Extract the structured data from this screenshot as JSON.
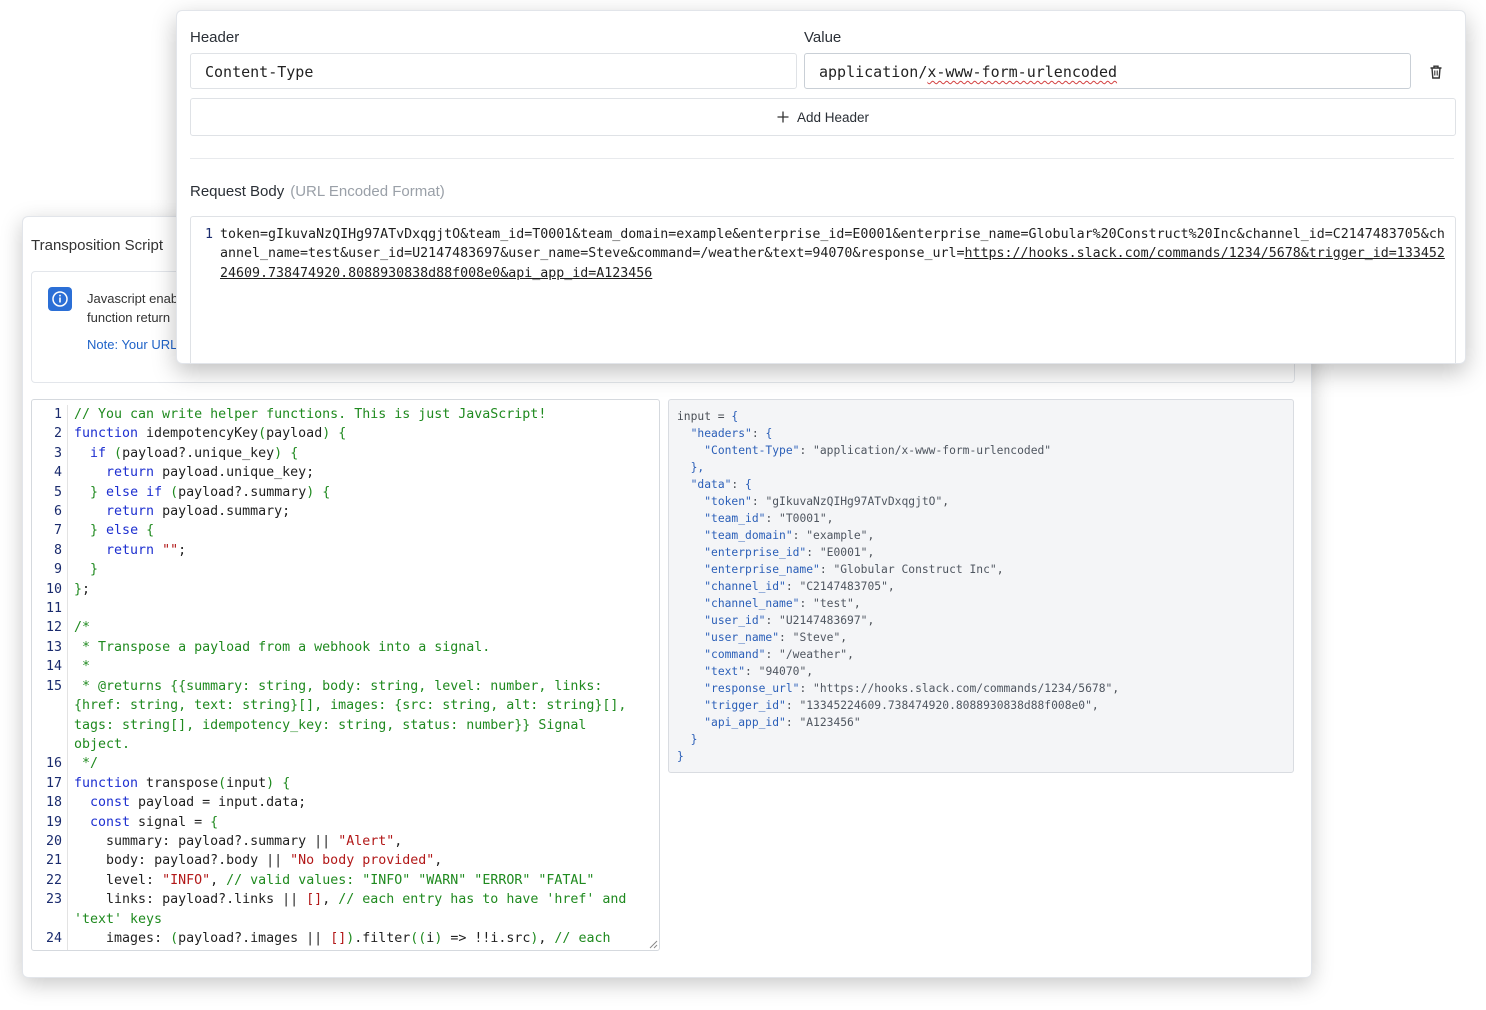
{
  "transposition": {
    "title": "Transposition Script",
    "info_line1": "Javascript enab",
    "info_line2": "function return",
    "info_note": "Note: Your URL-"
  },
  "code_editor": {
    "lines": [
      {
        "n": "1",
        "segments": [
          {
            "t": "// You can write helper functions. This is just JavaScript!",
            "c": "cm"
          }
        ]
      },
      {
        "n": "2",
        "segments": [
          {
            "t": "function",
            "c": "kw"
          },
          {
            "t": " idempotencyKey"
          },
          {
            "t": "(",
            "c": "pn"
          },
          {
            "t": "payload"
          },
          {
            "t": ")",
            "c": "pn"
          },
          {
            "t": " "
          },
          {
            "t": "{",
            "c": "pn"
          }
        ]
      },
      {
        "n": "3",
        "segments": [
          {
            "t": "  "
          },
          {
            "t": "if",
            "c": "kw"
          },
          {
            "t": " "
          },
          {
            "t": "(",
            "c": "pn"
          },
          {
            "t": "payload?.unique_key"
          },
          {
            "t": ")",
            "c": "pn"
          },
          {
            "t": " "
          },
          {
            "t": "{",
            "c": "pn"
          }
        ]
      },
      {
        "n": "4",
        "segments": [
          {
            "t": "    "
          },
          {
            "t": "return",
            "c": "kw"
          },
          {
            "t": " payload.unique_key;"
          }
        ]
      },
      {
        "n": "5",
        "segments": [
          {
            "t": "  "
          },
          {
            "t": "}",
            "c": "pn"
          },
          {
            "t": " "
          },
          {
            "t": "else",
            "c": "kw"
          },
          {
            "t": " "
          },
          {
            "t": "if",
            "c": "kw"
          },
          {
            "t": " "
          },
          {
            "t": "(",
            "c": "pn"
          },
          {
            "t": "payload?.summary"
          },
          {
            "t": ")",
            "c": "pn"
          },
          {
            "t": " "
          },
          {
            "t": "{",
            "c": "pn"
          }
        ]
      },
      {
        "n": "6",
        "segments": [
          {
            "t": "    "
          },
          {
            "t": "return",
            "c": "kw"
          },
          {
            "t": " payload.summary;"
          }
        ]
      },
      {
        "n": "7",
        "segments": [
          {
            "t": "  "
          },
          {
            "t": "}",
            "c": "pn"
          },
          {
            "t": " "
          },
          {
            "t": "else",
            "c": "kw"
          },
          {
            "t": " "
          },
          {
            "t": "{",
            "c": "pn"
          }
        ]
      },
      {
        "n": "8",
        "segments": [
          {
            "t": "    "
          },
          {
            "t": "return",
            "c": "kw"
          },
          {
            "t": " "
          },
          {
            "t": "\"\"",
            "c": "st"
          },
          {
            "t": ";"
          }
        ]
      },
      {
        "n": "9",
        "segments": [
          {
            "t": "  "
          },
          {
            "t": "}",
            "c": "pn"
          }
        ]
      },
      {
        "n": "10",
        "segments": [
          {
            "t": "}",
            "c": "pn"
          },
          {
            "t": ";"
          }
        ]
      },
      {
        "n": "11",
        "segments": [
          {
            "t": ""
          }
        ]
      },
      {
        "n": "12",
        "segments": [
          {
            "t": "/*",
            "c": "cm"
          }
        ]
      },
      {
        "n": "13",
        "segments": [
          {
            "t": " * Transpose a payload from a webhook into a signal.",
            "c": "cm"
          }
        ]
      },
      {
        "n": "14",
        "segments": [
          {
            "t": " *",
            "c": "cm"
          }
        ]
      },
      {
        "n": "15",
        "segments": [
          {
            "t": " * @returns {{summary: string, body: string, level: number, links: {href: string, text: string}[], images: {src: string, alt: string}[], tags: string[], idempotency_key: string, status: number}} Signal object.",
            "c": "cm"
          }
        ]
      },
      {
        "n": "16",
        "segments": [
          {
            "t": " */",
            "c": "cm"
          }
        ]
      },
      {
        "n": "17",
        "segments": [
          {
            "t": "function",
            "c": "kw"
          },
          {
            "t": " transpose"
          },
          {
            "t": "(",
            "c": "pn"
          },
          {
            "t": "input"
          },
          {
            "t": ")",
            "c": "pn"
          },
          {
            "t": " "
          },
          {
            "t": "{",
            "c": "pn"
          }
        ]
      },
      {
        "n": "18",
        "segments": [
          {
            "t": "  "
          },
          {
            "t": "const",
            "c": "kw"
          },
          {
            "t": " payload = input.data;"
          }
        ]
      },
      {
        "n": "19",
        "segments": [
          {
            "t": "  "
          },
          {
            "t": "const",
            "c": "kw"
          },
          {
            "t": " signal = "
          },
          {
            "t": "{",
            "c": "pn"
          }
        ]
      },
      {
        "n": "20",
        "segments": [
          {
            "t": "    summary: payload?.summary || "
          },
          {
            "t": "\"Alert\"",
            "c": "st"
          },
          {
            "t": ","
          }
        ]
      },
      {
        "n": "21",
        "segments": [
          {
            "t": "    body: payload?.body || "
          },
          {
            "t": "\"No body provided\"",
            "c": "st"
          },
          {
            "t": ","
          }
        ]
      },
      {
        "n": "22",
        "segments": [
          {
            "t": "    level: "
          },
          {
            "t": "\"INFO\"",
            "c": "st"
          },
          {
            "t": ", "
          },
          {
            "t": "// valid values: \"INFO\" \"WARN\" \"ERROR\" \"FATAL\"",
            "c": "cm"
          }
        ]
      },
      {
        "n": "23",
        "segments": [
          {
            "t": "    links: payload?.links || "
          },
          {
            "t": "[]",
            "c": "st"
          },
          {
            "t": ", "
          },
          {
            "t": "// each entry has to have 'href' and 'text' keys",
            "c": "cm"
          }
        ]
      },
      {
        "n": "24",
        "segments": [
          {
            "t": "    images: "
          },
          {
            "t": "(",
            "c": "pn"
          },
          {
            "t": "payload?.images || "
          },
          {
            "t": "[]",
            "c": "st"
          },
          {
            "t": ")",
            "c": "pn"
          },
          {
            "t": ".filter"
          },
          {
            "t": "((",
            "c": "pn"
          },
          {
            "t": "i"
          },
          {
            "t": ")",
            "c": "pn"
          },
          {
            "t": " => !!i.src"
          },
          {
            "t": ")",
            "c": "pn"
          },
          {
            "t": ", "
          },
          {
            "t": "// each entry has to have 'src' and 'alt' keys",
            "c": "cm"
          }
        ]
      }
    ]
  },
  "json_preview": {
    "lines": [
      [
        {
          "t": "input = "
        },
        {
          "t": "{",
          "c": "jp"
        }
      ],
      [
        {
          "t": "  "
        },
        {
          "t": "\"headers\"",
          "c": "jk"
        },
        {
          "t": ": "
        },
        {
          "t": "{",
          "c": "jp"
        }
      ],
      [
        {
          "t": "    "
        },
        {
          "t": "\"Content-Type\"",
          "c": "jk"
        },
        {
          "t": ": "
        },
        {
          "t": "\"application/x-www-form-urlencoded\"",
          "c": "jv"
        }
      ],
      [
        {
          "t": "  "
        },
        {
          "t": "},",
          "c": "jp"
        }
      ],
      [
        {
          "t": "  "
        },
        {
          "t": "\"data\"",
          "c": "jk"
        },
        {
          "t": ": "
        },
        {
          "t": "{",
          "c": "jp"
        }
      ],
      [
        {
          "t": "    "
        },
        {
          "t": "\"token\"",
          "c": "jk"
        },
        {
          "t": ": "
        },
        {
          "t": "\"gIkuvaNzQIHg97ATvDxqgjtO\"",
          "c": "jv"
        },
        {
          "t": ","
        }
      ],
      [
        {
          "t": "    "
        },
        {
          "t": "\"team_id\"",
          "c": "jk"
        },
        {
          "t": ": "
        },
        {
          "t": "\"T0001\"",
          "c": "jv"
        },
        {
          "t": ","
        }
      ],
      [
        {
          "t": "    "
        },
        {
          "t": "\"team_domain\"",
          "c": "jk"
        },
        {
          "t": ": "
        },
        {
          "t": "\"example\"",
          "c": "jv"
        },
        {
          "t": ","
        }
      ],
      [
        {
          "t": "    "
        },
        {
          "t": "\"enterprise_id\"",
          "c": "jk"
        },
        {
          "t": ": "
        },
        {
          "t": "\"E0001\"",
          "c": "jv"
        },
        {
          "t": ","
        }
      ],
      [
        {
          "t": "    "
        },
        {
          "t": "\"enterprise_name\"",
          "c": "jk"
        },
        {
          "t": ": "
        },
        {
          "t": "\"Globular Construct Inc\"",
          "c": "jv"
        },
        {
          "t": ","
        }
      ],
      [
        {
          "t": "    "
        },
        {
          "t": "\"channel_id\"",
          "c": "jk"
        },
        {
          "t": ": "
        },
        {
          "t": "\"C2147483705\"",
          "c": "jv"
        },
        {
          "t": ","
        }
      ],
      [
        {
          "t": "    "
        },
        {
          "t": "\"channel_name\"",
          "c": "jk"
        },
        {
          "t": ": "
        },
        {
          "t": "\"test\"",
          "c": "jv"
        },
        {
          "t": ","
        }
      ],
      [
        {
          "t": "    "
        },
        {
          "t": "\"user_id\"",
          "c": "jk"
        },
        {
          "t": ": "
        },
        {
          "t": "\"U2147483697\"",
          "c": "jv"
        },
        {
          "t": ","
        }
      ],
      [
        {
          "t": "    "
        },
        {
          "t": "\"user_name\"",
          "c": "jk"
        },
        {
          "t": ": "
        },
        {
          "t": "\"Steve\"",
          "c": "jv"
        },
        {
          "t": ","
        }
      ],
      [
        {
          "t": "    "
        },
        {
          "t": "\"command\"",
          "c": "jk"
        },
        {
          "t": ": "
        },
        {
          "t": "\"/weather\"",
          "c": "jv"
        },
        {
          "t": ","
        }
      ],
      [
        {
          "t": "    "
        },
        {
          "t": "\"text\"",
          "c": "jk"
        },
        {
          "t": ": "
        },
        {
          "t": "\"94070\"",
          "c": "jv"
        },
        {
          "t": ","
        }
      ],
      [
        {
          "t": "    "
        },
        {
          "t": "\"response_url\"",
          "c": "jk"
        },
        {
          "t": ": "
        },
        {
          "t": "\"https://hooks.slack.com/commands/1234/5678\"",
          "c": "jv"
        },
        {
          "t": ","
        }
      ],
      [
        {
          "t": "    "
        },
        {
          "t": "\"trigger_id\"",
          "c": "jk"
        },
        {
          "t": ": "
        },
        {
          "t": "\"13345224609.738474920.8088930838d88f008e0\"",
          "c": "jv"
        },
        {
          "t": ","
        }
      ],
      [
        {
          "t": "    "
        },
        {
          "t": "\"api_app_id\"",
          "c": "jk"
        },
        {
          "t": ": "
        },
        {
          "t": "\"A123456\"",
          "c": "jv"
        }
      ],
      [
        {
          "t": "  "
        },
        {
          "t": "}",
          "c": "jp"
        }
      ],
      [
        {
          "t": "}",
          "c": "jp"
        }
      ]
    ]
  },
  "headers_section": {
    "header_label": "Header",
    "value_label": "Value",
    "header_value": "Content-Type",
    "value_prefix": "application/",
    "value_flagged": "x-www-form-urlencoded",
    "add_header_label": "Add Header"
  },
  "request_body": {
    "label": "Request Body",
    "hint": "(URL Encoded Format)",
    "line_number": "1",
    "text_before_url": "token=gIkuvaNzQIHg97ATvDxqgjtO&team_id=T0001&team_domain=example&enterprise_id=E0001&enterprise_name=Globular%20Construct%20Inc&channel_id=C2147483705&channel_name=test&user_id=U2147483697&user_name=Steve&command=/weather&text=94070&response_url=",
    "url_part": "https://hooks.slack.com/commands/1234/5678&trigger_id=13345224609.738474920.8088930838d88f008e0&api_app_id=A123456"
  },
  "colors": {
    "keyword": "#1d2fd0",
    "comment": "#1f8a1f",
    "string": "#b21818",
    "info_icon": "#2b6fd6",
    "note_link": "#1f63c8"
  },
  "icons": {
    "info": "info-icon",
    "trash": "trash-icon",
    "add": "plus-icon"
  }
}
